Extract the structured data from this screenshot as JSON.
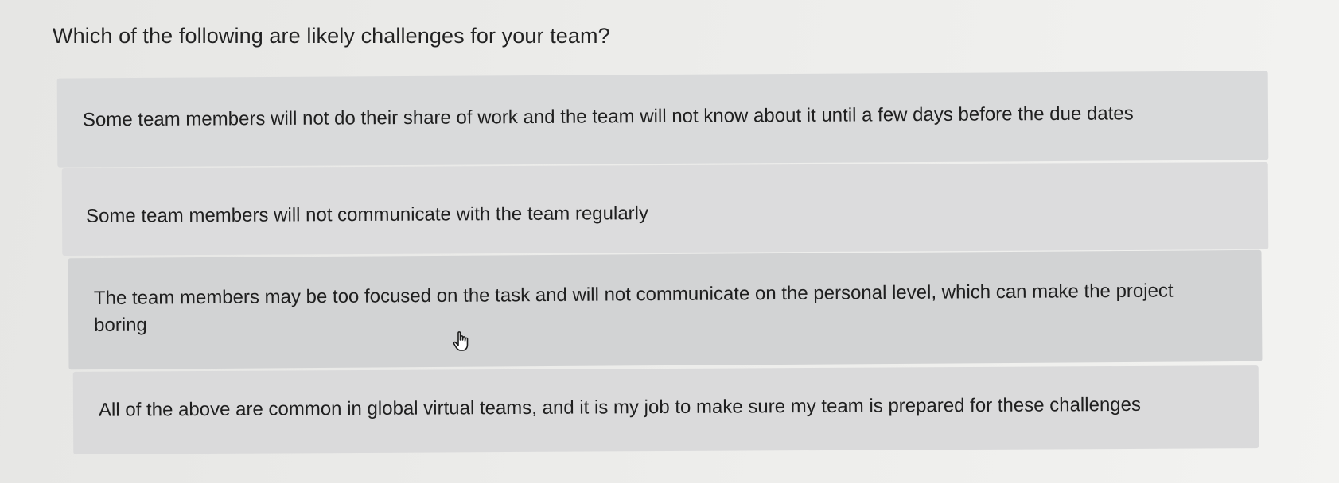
{
  "question": {
    "text": "Which of the following are likely challenges for your team?"
  },
  "options": [
    {
      "label": "Some team members will not do their share of work and the team will not know about it until a few days before the due dates"
    },
    {
      "label": "Some team members will not communicate with the team regularly"
    },
    {
      "label": "The team members may be too focused on the task and will not communicate on the personal level, which can make the project boring"
    },
    {
      "label": "All of the above are common in global virtual teams, and it is my job to make sure my team is prepared for these challenges"
    }
  ],
  "colors": {
    "background": "#ececea",
    "option_background": "#d9dadb",
    "option_hover_background": "#d2d3d4",
    "text": "#1f1f1f"
  },
  "cursor": {
    "icon": "hand-pointer-icon"
  }
}
